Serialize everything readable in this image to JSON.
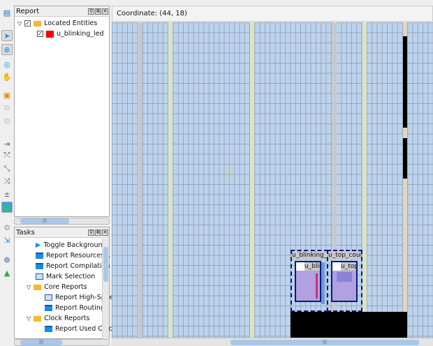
{
  "report": {
    "title": "Report",
    "root": "Located Entities",
    "child": "u_blinking_led",
    "child_color": "#ff0000"
  },
  "tasks": {
    "title": "Tasks",
    "items": [
      {
        "label": "Toggle Background",
        "icon": "play-icon"
      },
      {
        "label": "Report Resources...",
        "icon": "report-icon"
      },
      {
        "label": "Report Compilation",
        "icon": "report-icon"
      },
      {
        "label": "Mark Selection",
        "icon": "table-icon"
      },
      {
        "label": "Core Reports",
        "icon": "folder-icon"
      },
      {
        "label": "Report High-Speed",
        "icon": "table-icon"
      },
      {
        "label": "Report Routing",
        "icon": "report-icon"
      },
      {
        "label": "Clock Reports",
        "icon": "folder-icon"
      },
      {
        "label": "Report Used Clocks",
        "icon": "report-icon"
      }
    ]
  },
  "main": {
    "coordinate": "Coordinate: (44, 18)",
    "regions": [
      {
        "label": "u_blinking_led",
        "inner": "u_blinking_led"
      },
      {
        "label": "u_top_counter",
        "inner": "u_top_counter"
      }
    ]
  },
  "pin_buttons": {
    "pin": "⚲",
    "float": "⧉",
    "close": "✕"
  }
}
